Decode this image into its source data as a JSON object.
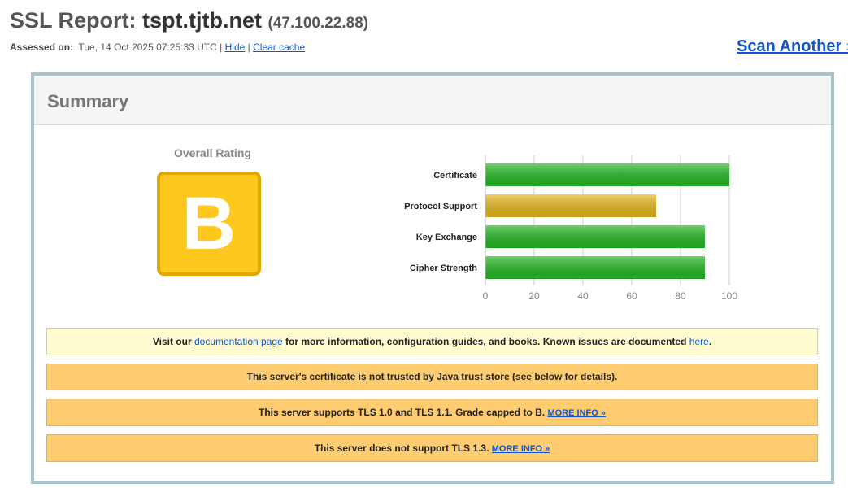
{
  "header": {
    "title_prefix": "SSL Report: ",
    "host": "tspt.tjtb.net",
    "ip": "(47.100.22.88)",
    "assessed_label": "Assessed on:",
    "assessed_value": "Tue, 14 Oct 2025 07:25:33 UTC |",
    "hide_link": "Hide",
    "separator": "|",
    "clear_cache_link": "Clear cache",
    "scan_another": "Scan Another »"
  },
  "summary": {
    "heading": "Summary",
    "overall_rating_label": "Overall Rating",
    "grade": "B",
    "grade_color": "#ffc81e"
  },
  "chart_data": {
    "type": "bar",
    "orientation": "horizontal",
    "categories": [
      "Certificate",
      "Protocol Support",
      "Key Exchange",
      "Cipher Strength"
    ],
    "values": [
      100,
      70,
      90,
      90
    ],
    "colors": [
      "#22b822",
      "#e8b81a",
      "#22b822",
      "#22b822"
    ],
    "xlim": [
      0,
      100
    ],
    "xticks": [
      0,
      20,
      40,
      60,
      80,
      100
    ],
    "grid": true
  },
  "notices": {
    "doc_prefix": "Visit our ",
    "doc_link": "documentation page",
    "doc_middle": " for more information, configuration guides, and books. Known issues are documented ",
    "doc_here": "here",
    "doc_suffix": ".",
    "java_trust": "This server's certificate is not trusted by Java trust store (see below for details).",
    "tls_capped": "This server supports TLS 1.0 and TLS 1.1. Grade capped to B.",
    "tls13": "This server does not support TLS 1.3.",
    "more_info": "MORE INFO »"
  }
}
